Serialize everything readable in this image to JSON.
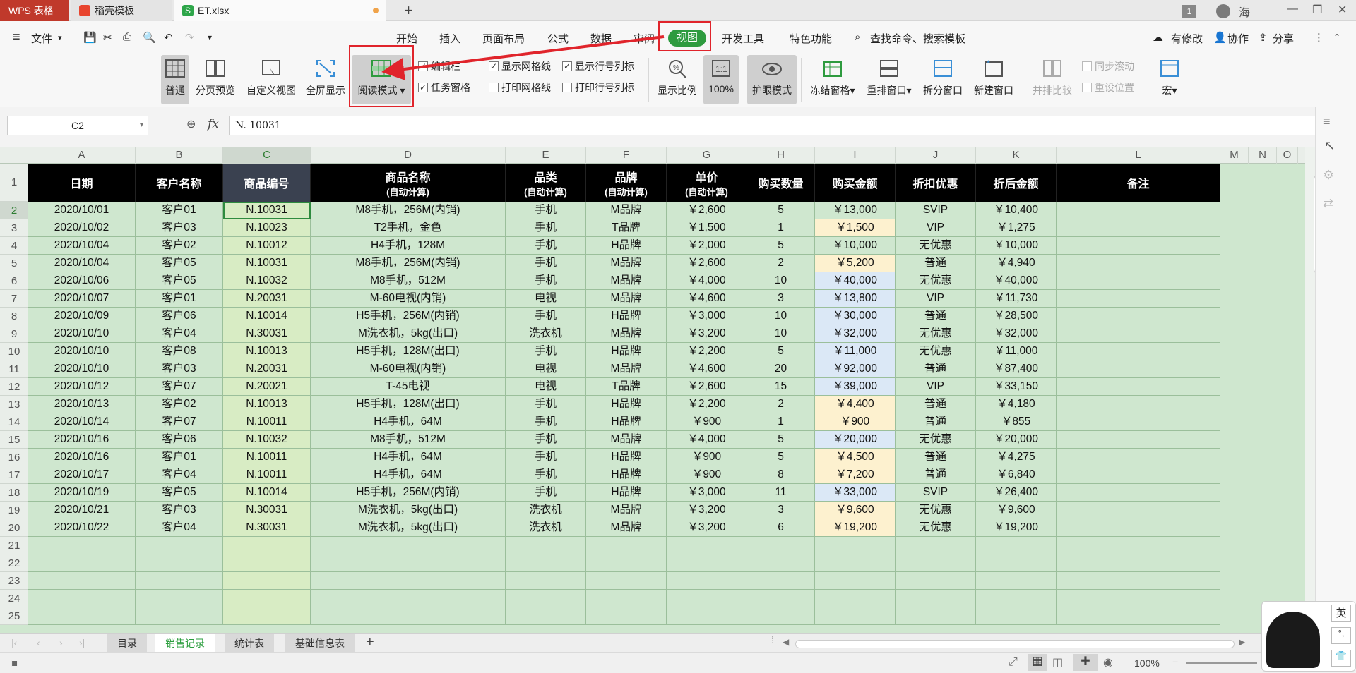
{
  "tabs": {
    "app": "WPS 表格",
    "template": "稻壳模板",
    "file": "ET.xlsx"
  },
  "user": {
    "name": "海",
    "badge": "1"
  },
  "menu": {
    "file": "文件",
    "items": [
      "开始",
      "插入",
      "页面布局",
      "公式",
      "数据",
      "审阅",
      "视图",
      "开发工具",
      "特色功能"
    ],
    "search": "查找命令、搜索模板",
    "right": [
      "有修改",
      "协作",
      "分享"
    ]
  },
  "ribbon": {
    "normal": "普通",
    "page_break": "分页预览",
    "custom_view": "自定义视图",
    "fullscreen": "全屏显示",
    "reading": "阅读模式",
    "checks": [
      {
        "label": "编辑栏",
        "checked": true
      },
      {
        "label": "显示网格线",
        "checked": true
      },
      {
        "label": "显示行号列标",
        "checked": true
      },
      {
        "label": "任务窗格",
        "checked": true
      },
      {
        "label": "打印网格线",
        "checked": false
      },
      {
        "label": "打印行号列标",
        "checked": false
      }
    ],
    "zoom_ratio": "显示比例",
    "zoom_100": "100%",
    "eye_mode": "护眼模式",
    "freeze": "冻结窗格",
    "rearrange": "重排窗口",
    "split": "拆分窗口",
    "new_window": "新建窗口",
    "side_by_side": "并排比较",
    "sync_scroll": "同步滚动",
    "reset_pos": "重设位置",
    "macro": "宏"
  },
  "formula_bar": {
    "name_box": "C2",
    "fx": "fx",
    "value": "N. 10031"
  },
  "columns": [
    "A",
    "B",
    "C",
    "D",
    "E",
    "F",
    "G",
    "H",
    "I",
    "J",
    "K",
    "L",
    "M",
    "N",
    "O"
  ],
  "header": [
    {
      "main": "日期",
      "sub": ""
    },
    {
      "main": "客户名称",
      "sub": ""
    },
    {
      "main": "商品编号",
      "sub": ""
    },
    {
      "main": "商品名称",
      "sub": "(自动计算)"
    },
    {
      "main": "品类",
      "sub": "(自动计算)"
    },
    {
      "main": "品牌",
      "sub": "(自动计算)"
    },
    {
      "main": "单价",
      "sub": "(自动计算)"
    },
    {
      "main": "购买数量",
      "sub": ""
    },
    {
      "main": "购买金额",
      "sub": ""
    },
    {
      "main": "折扣优惠",
      "sub": ""
    },
    {
      "main": "折后金额",
      "sub": ""
    },
    {
      "main": "备注",
      "sub": ""
    }
  ],
  "rows": [
    [
      "2020/10/01",
      "客户01",
      "N.10031",
      "M8手机，256M(内销)",
      "手机",
      "M品牌",
      "￥2,600",
      "5",
      "￥13,000",
      "SVIP",
      "￥10,400",
      ""
    ],
    [
      "2020/10/02",
      "客户03",
      "N.10023",
      "T2手机，金色",
      "手机",
      "T品牌",
      "￥1,500",
      "1",
      "￥1,500",
      "VIP",
      "￥1,275",
      ""
    ],
    [
      "2020/10/04",
      "客户02",
      "N.10012",
      "H4手机，128M",
      "手机",
      "H品牌",
      "￥2,000",
      "5",
      "￥10,000",
      "无优惠",
      "￥10,000",
      ""
    ],
    [
      "2020/10/04",
      "客户05",
      "N.10031",
      "M8手机，256M(内销)",
      "手机",
      "M品牌",
      "￥2,600",
      "2",
      "￥5,200",
      "普通",
      "￥4,940",
      ""
    ],
    [
      "2020/10/06",
      "客户05",
      "N.10032",
      "M8手机，512M",
      "手机",
      "M品牌",
      "￥4,000",
      "10",
      "￥40,000",
      "无优惠",
      "￥40,000",
      ""
    ],
    [
      "2020/10/07",
      "客户01",
      "N.20031",
      "M-60电视(内销)",
      "电视",
      "M品牌",
      "￥4,600",
      "3",
      "￥13,800",
      "VIP",
      "￥11,730",
      ""
    ],
    [
      "2020/10/09",
      "客户06",
      "N.10014",
      "H5手机，256M(内销)",
      "手机",
      "H品牌",
      "￥3,000",
      "10",
      "￥30,000",
      "普通",
      "￥28,500",
      ""
    ],
    [
      "2020/10/10",
      "客户04",
      "N.30031",
      "M洗衣机，5kg(出口)",
      "洗衣机",
      "M品牌",
      "￥3,200",
      "10",
      "￥32,000",
      "无优惠",
      "￥32,000",
      ""
    ],
    [
      "2020/10/10",
      "客户08",
      "N.10013",
      "H5手机，128M(出口)",
      "手机",
      "H品牌",
      "￥2,200",
      "5",
      "￥11,000",
      "无优惠",
      "￥11,000",
      ""
    ],
    [
      "2020/10/10",
      "客户03",
      "N.20031",
      "M-60电视(内销)",
      "电视",
      "M品牌",
      "￥4,600",
      "20",
      "￥92,000",
      "普通",
      "￥87,400",
      ""
    ],
    [
      "2020/10/12",
      "客户07",
      "N.20021",
      "T-45电视",
      "电视",
      "T品牌",
      "￥2,600",
      "15",
      "￥39,000",
      "VIP",
      "￥33,150",
      ""
    ],
    [
      "2020/10/13",
      "客户02",
      "N.10013",
      "H5手机，128M(出口)",
      "手机",
      "H品牌",
      "￥2,200",
      "2",
      "￥4,400",
      "普通",
      "￥4,180",
      ""
    ],
    [
      "2020/10/14",
      "客户07",
      "N.10011",
      "H4手机，64M",
      "手机",
      "H品牌",
      "￥900",
      "1",
      "￥900",
      "普通",
      "￥855",
      ""
    ],
    [
      "2020/10/16",
      "客户06",
      "N.10032",
      "M8手机，512M",
      "手机",
      "M品牌",
      "￥4,000",
      "5",
      "￥20,000",
      "无优惠",
      "￥20,000",
      ""
    ],
    [
      "2020/10/16",
      "客户01",
      "N.10011",
      "H4手机，64M",
      "手机",
      "H品牌",
      "￥900",
      "5",
      "￥4,500",
      "普通",
      "￥4,275",
      ""
    ],
    [
      "2020/10/17",
      "客户04",
      "N.10011",
      "H4手机，64M",
      "手机",
      "H品牌",
      "￥900",
      "8",
      "￥7,200",
      "普通",
      "￥6,840",
      ""
    ],
    [
      "2020/10/19",
      "客户05",
      "N.10014",
      "H5手机，256M(内销)",
      "手机",
      "H品牌",
      "￥3,000",
      "11",
      "￥33,000",
      "SVIP",
      "￥26,400",
      ""
    ],
    [
      "2020/10/21",
      "客户03",
      "N.30031",
      "M洗衣机，5kg(出口)",
      "洗衣机",
      "M品牌",
      "￥3,200",
      "3",
      "￥9,600",
      "无优惠",
      "￥9,600",
      ""
    ],
    [
      "2020/10/22",
      "客户04",
      "N.30031",
      "M洗衣机，5kg(出口)",
      "洗衣机",
      "M品牌",
      "￥3,200",
      "6",
      "￥19,200",
      "无优惠",
      "￥19,200",
      ""
    ]
  ],
  "amount_highlight": [
    "",
    "yellow",
    "",
    "yellow",
    "blue",
    "blue",
    "blue",
    "blue",
    "blue",
    "blue",
    "blue",
    "yellow",
    "yellow",
    "blue",
    "yellow",
    "yellow",
    "blue",
    "yellow",
    "yellow"
  ],
  "row_numbers": [
    "1",
    "2",
    "3",
    "4",
    "5",
    "6",
    "7",
    "8",
    "9",
    "10",
    "11",
    "12",
    "13",
    "14",
    "15",
    "16",
    "17",
    "18",
    "19",
    "20",
    "21",
    "22",
    "23",
    "24",
    "25"
  ],
  "sheets": {
    "tabs": [
      "目录",
      "销售记录",
      "统计表",
      "基础信息表"
    ],
    "active": 1
  },
  "status": {
    "zoom": "100%"
  },
  "ime": {
    "lang": "英"
  },
  "colors": {
    "accent": "#2e9b3f",
    "annotation": "#e0242b",
    "sheet_bg": "#cfe7cf",
    "header_bg": "#000000"
  }
}
